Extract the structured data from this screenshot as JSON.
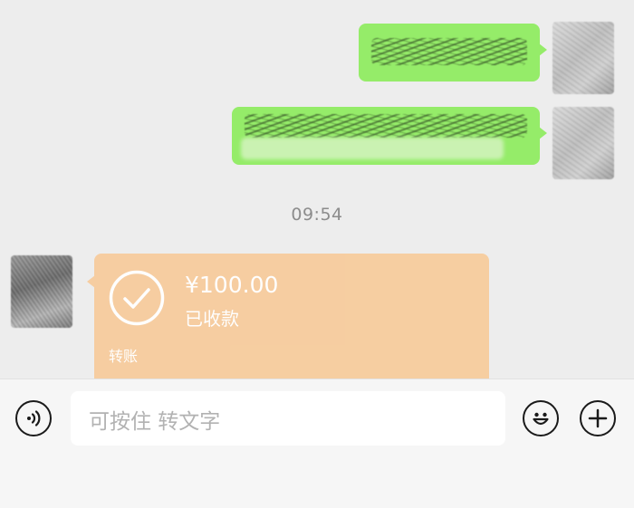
{
  "messages": {
    "timestamp": "09:54",
    "transfer": {
      "amount": "¥100.00",
      "status": "已收款",
      "label": "转账",
      "icon": "check-circle-icon",
      "color": "#f7cc9d"
    },
    "sent_bubble_color": "#95ec69"
  },
  "input_bar": {
    "placeholder": "可按住 转文字",
    "voice_icon": "voice-icon",
    "emoji_icon": "emoji-icon",
    "plus_icon": "plus-icon"
  }
}
